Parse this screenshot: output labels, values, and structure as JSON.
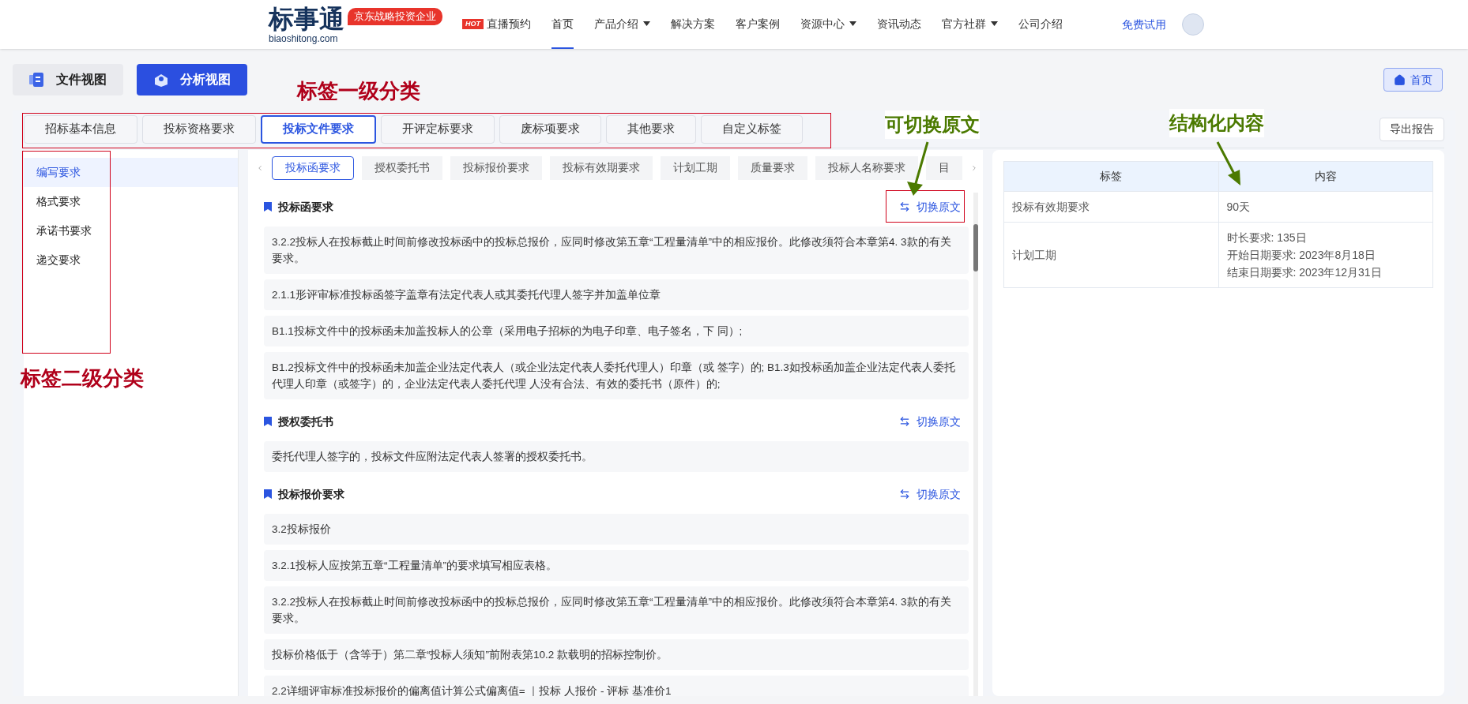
{
  "header": {
    "logo": {
      "name": "标事通",
      "domain": "biaoshitong.com",
      "badge": "京东战略投资企业"
    },
    "nav": [
      {
        "label": "直播预约",
        "hot": "HOT",
        "menu": false,
        "selected": false
      },
      {
        "label": "首页",
        "menu": false,
        "selected": true
      },
      {
        "label": "产品介绍",
        "menu": true,
        "selected": false
      },
      {
        "label": "解决方案",
        "menu": false,
        "selected": false
      },
      {
        "label": "客户案例",
        "menu": false,
        "selected": false
      },
      {
        "label": "资源中心",
        "menu": true,
        "selected": false
      },
      {
        "label": "资讯动态",
        "menu": false,
        "selected": false
      },
      {
        "label": "官方社群",
        "menu": true,
        "selected": false
      },
      {
        "label": "公司介绍",
        "menu": false,
        "selected": false
      }
    ],
    "trial": "免费试用"
  },
  "views": [
    {
      "label": "文件视图",
      "selected": false
    },
    {
      "label": "分析视图",
      "selected": true
    }
  ],
  "home_button": "首页",
  "primary_tabs": [
    {
      "label": "招标基本信息",
      "selected": false
    },
    {
      "label": "投标资格要求",
      "selected": false
    },
    {
      "label": "投标文件要求",
      "selected": true
    },
    {
      "label": "开评定标要求",
      "selected": false
    },
    {
      "label": "废标项要求",
      "selected": false
    },
    {
      "label": "其他要求",
      "selected": false
    },
    {
      "label": "自定义标签",
      "selected": false
    }
  ],
  "export_button": "导出报告",
  "sidebar": [
    {
      "label": "编写要求",
      "selected": true
    },
    {
      "label": "格式要求",
      "selected": false
    },
    {
      "label": "承诺书要求",
      "selected": false
    },
    {
      "label": "递交要求",
      "selected": false
    }
  ],
  "sub_tabs": [
    {
      "label": "投标函要求",
      "selected": true
    },
    {
      "label": "授权委托书",
      "selected": false
    },
    {
      "label": "投标报价要求",
      "selected": false
    },
    {
      "label": "投标有效期要求",
      "selected": false
    },
    {
      "label": "计划工期",
      "selected": false
    },
    {
      "label": "质量要求",
      "selected": false
    },
    {
      "label": "投标人名称要求",
      "selected": false
    },
    {
      "label": "目",
      "selected": false
    }
  ],
  "sections": [
    {
      "title": "投标函要求",
      "toggle": "切换原文",
      "items": [
        "3.2.2投标人在投标截止时间前修改投标函中的投标总报价，应同时修改第五章“工程量清单”中的相应报价。此修改须符合本章第4. 3款的有关要求。",
        "2.1.1形评审标准投标函签字盖章有法定代表人或其委托代理人签字并加盖单位章",
        "B1.1投标文件中的投标函未加盖投标人的公章（采用电子招标的为电子印章、电子签名，下 同）;",
        "B1.2投标文件中的投标函未加盖企业法定代表人（或企业法定代表人委托代理人）印章（或 签字）的; B1.3如投标函加盖企业法定代表人委托代理人印章（或签字）的，企业法定代表人委托代理 人没有合法、有效的委托书（原件）的;"
      ]
    },
    {
      "title": "授权委托书",
      "toggle": "切换原文",
      "items": [
        "委托代理人签字的，投标文件应附法定代表人签署的授权委托书。"
      ]
    },
    {
      "title": "投标报价要求",
      "toggle": "切换原文",
      "items": [
        "3.2投标报价",
        "3.2.1投标人应按第五章“工程量清单”的要求填写相应表格。",
        "3.2.2投标人在投标截止时间前修改投标函中的投标总报价，应同时修改第五章“工程量清单”中的相应报价。此修改须符合本章第4. 3款的有关要求。",
        "投标价格低于（含等于）第二章“投标人须知”前附表第10.2 款载明的招标控制价。",
        "2.2详细评审标准投标报价的偏离值计算公式偏离值= ｜投标 人报价  - 评标 基准价1"
      ]
    }
  ],
  "table": {
    "columns": [
      "标签",
      "内容"
    ],
    "rows": [
      {
        "label": "投标有效期要求",
        "content": [
          "90天"
        ]
      },
      {
        "label": "计划工期",
        "content": [
          "时长要求: 135日",
          "开始日期要求: 2023年8月18日",
          "结束日期要求: 2023年12月31日"
        ]
      }
    ]
  },
  "annotations": {
    "tabs_label": "标签一级分类",
    "sidebar_label": "标签二级分类",
    "toggle_label": "可切换原文",
    "table_label": "结构化内容"
  }
}
